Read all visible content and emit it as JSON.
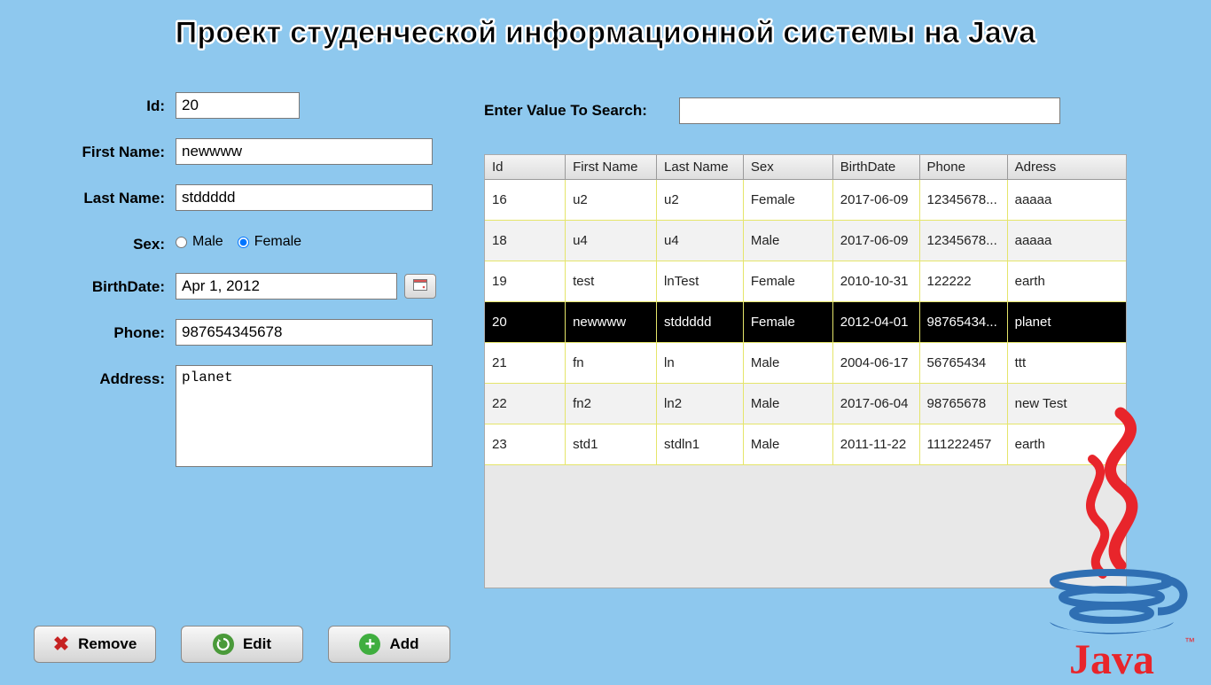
{
  "title": "Проект студенческой информационной системы на Java",
  "form": {
    "labels": {
      "id": "Id:",
      "first_name": "First Name:",
      "last_name": "Last Name:",
      "sex": "Sex:",
      "birthdate": "BirthDate:",
      "phone": "Phone:",
      "address": "Address:"
    },
    "values": {
      "id": "20",
      "first_name": "newwww",
      "last_name": "stddddd",
      "birthdate": "Apr 1, 2012",
      "phone": "987654345678",
      "address": "planet"
    },
    "sex_options": {
      "male": "Male",
      "female": "Female",
      "selected": "female"
    }
  },
  "buttons": {
    "remove": "Remove",
    "edit": "Edit",
    "add": "Add"
  },
  "search": {
    "label": "Enter Value To Search:",
    "value": ""
  },
  "table": {
    "columns": [
      "Id",
      "First Name",
      "Last Name",
      "Sex",
      "BirthDate",
      "Phone",
      "Adress"
    ],
    "selected_id": "20",
    "rows": [
      {
        "id": "16",
        "first_name": "u2",
        "last_name": "u2",
        "sex": "Female",
        "birthdate": "2017-06-09",
        "phone": "12345678...",
        "address": "aaaaa"
      },
      {
        "id": "18",
        "first_name": "u4",
        "last_name": "u4",
        "sex": "Male",
        "birthdate": "2017-06-09",
        "phone": "12345678...",
        "address": "aaaaa"
      },
      {
        "id": "19",
        "first_name": "test",
        "last_name": "lnTest",
        "sex": "Female",
        "birthdate": "2010-10-31",
        "phone": "122222",
        "address": "earth"
      },
      {
        "id": "20",
        "first_name": "newwww",
        "last_name": "stddddd",
        "sex": "Female",
        "birthdate": "2012-04-01",
        "phone": "98765434...",
        "address": "planet"
      },
      {
        "id": "21",
        "first_name": "fn",
        "last_name": "ln",
        "sex": "Male",
        "birthdate": "2004-06-17",
        "phone": "56765434",
        "address": "ttt"
      },
      {
        "id": "22",
        "first_name": "fn2",
        "last_name": "ln2",
        "sex": "Male",
        "birthdate": "2017-06-04",
        "phone": "98765678",
        "address": "new Test"
      },
      {
        "id": "23",
        "first_name": "std1",
        "last_name": "stdln1",
        "sex": "Male",
        "birthdate": "2011-11-22",
        "phone": "111222457",
        "address": "earth"
      }
    ]
  },
  "col_widths": [
    "88",
    "100",
    "95",
    "98",
    "95",
    "92",
    "130"
  ],
  "logo_text": "Java"
}
